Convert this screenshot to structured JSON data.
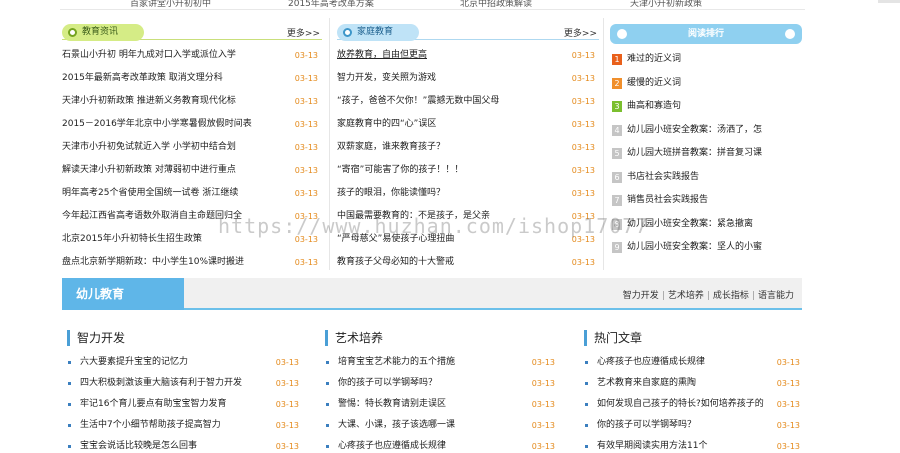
{
  "top_strip": [
    "百家讲堂小升初初中",
    "2015年高考改革方案",
    "北京中招政策解读",
    "天津小升初新政策"
  ],
  "col1": {
    "title": "教育资讯",
    "more": "更多>>",
    "items": [
      {
        "title": "石景山小升初 明年九成对口入学或派位入学",
        "date": "03-13"
      },
      {
        "title": "2015年最新高考改革政策 取消文理分科",
        "date": "03-13"
      },
      {
        "title": "天津小升初新政策 推进新义务教育现代化标",
        "date": "03-13"
      },
      {
        "title": "2015－2016学年北京中小学寒暑假放假时间表",
        "date": "03-13"
      },
      {
        "title": "天津市小升初免试就近入学 小学初中结合划",
        "date": "03-13"
      },
      {
        "title": "解读天津小升初新政策 对薄弱初中进行重点",
        "date": "03-13"
      },
      {
        "title": "明年高考25个省使用全国统一试卷 浙江继续",
        "date": "03-13"
      },
      {
        "title": "今年起江西省高考语数外取消自主命题回归全",
        "date": "03-13"
      },
      {
        "title": "北京2015年小升初特长生招生政策",
        "date": "03-13"
      },
      {
        "title": "盘点北京新学期新政：中小学生10%课时搬进",
        "date": "03-13"
      }
    ]
  },
  "col2": {
    "title": "家庭教育",
    "more": "更多>>",
    "items": [
      {
        "title": "放养教育，自由但更高",
        "date": "03-13"
      },
      {
        "title": "智力开发，变关照为游戏",
        "date": "03-13"
      },
      {
        "title": "“孩子，爸爸不欠你！”震撼无数中国父母",
        "date": "03-13"
      },
      {
        "title": "家庭教育中的四“心”误区",
        "date": "03-13"
      },
      {
        "title": "双薪家庭，谁来教育孩子？",
        "date": "03-13"
      },
      {
        "title": "“寄宿”可能害了你的孩子！！！",
        "date": "03-13"
      },
      {
        "title": "孩子的眼泪，你能读懂吗？",
        "date": "03-13"
      },
      {
        "title": "中国最需要教育的：不是孩子，是父亲",
        "date": "03-13"
      },
      {
        "title": "“严母慈父”易使孩子心理扭曲",
        "date": "03-13"
      },
      {
        "title": "教育孩子父母必知的十大警戒",
        "date": "03-13"
      }
    ]
  },
  "rank": {
    "title": "阅读排行",
    "items": [
      {
        "num": "1",
        "title": "难过的近义词"
      },
      {
        "num": "2",
        "title": "缓慢的近义词"
      },
      {
        "num": "3",
        "title": "曲高和寡造句"
      },
      {
        "num": "4",
        "title": "幼儿园小班安全教案：汤洒了，怎"
      },
      {
        "num": "5",
        "title": "幼儿园大班拼音教案：拼音复习课"
      },
      {
        "num": "6",
        "title": "书店社会实践报告"
      },
      {
        "num": "7",
        "title": "销售员社会实践报告"
      },
      {
        "num": "8",
        "title": "幼儿园小班安全教案：紧急撤离"
      },
      {
        "num": "9",
        "title": "幼儿园小班安全教案：坚人的小蜜"
      }
    ]
  },
  "watermark": "https://www.huzhan.com/ishop17077",
  "band": {
    "title": "幼儿教育",
    "nav": [
      "智力开发",
      "艺术培养",
      "成长指标",
      "语言能力"
    ]
  },
  "sections": [
    {
      "title": "智力开发",
      "items": [
        {
          "title": "六大要素提升宝宝的记忆力",
          "date": "03-13"
        },
        {
          "title": "四大积极刺激该重大脑该有利于智力开发",
          "date": "03-13"
        },
        {
          "title": "牢记16个育儿要点有助宝宝智力发育",
          "date": "03-13"
        },
        {
          "title": "生活中7个小细节帮助孩子提高智力",
          "date": "03-13"
        },
        {
          "title": "宝宝会说话比较晚是怎么回事",
          "date": "03-13"
        }
      ]
    },
    {
      "title": "艺术培养",
      "items": [
        {
          "title": "培育宝宝艺术能力的五个措施",
          "date": "03-13"
        },
        {
          "title": "你的孩子可以学钢琴吗？",
          "date": "03-13"
        },
        {
          "title": "警惕：特长教育请别走误区",
          "date": "03-13"
        },
        {
          "title": "大课、小课，孩子该选哪一课",
          "date": "03-13"
        },
        {
          "title": "心疼孩子也应遵循成长规律",
          "date": "03-13"
        }
      ]
    },
    {
      "title": "热门文章",
      "items": [
        {
          "title": "心疼孩子也应遵循成长规律",
          "date": "03-13"
        },
        {
          "title": "艺术教育来自家庭的熏陶",
          "date": "03-13"
        },
        {
          "title": "如何发现自己孩子的特长?如何培养孩子的",
          "date": "03-13"
        },
        {
          "title": "你的孩子可以学钢琴吗？",
          "date": "03-13"
        },
        {
          "title": "有效早期阅读实用方法11个",
          "date": "03-13"
        }
      ]
    }
  ]
}
